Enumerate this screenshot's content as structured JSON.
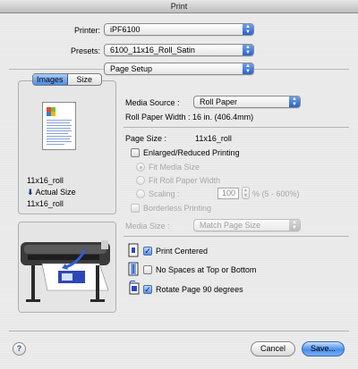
{
  "window": {
    "title": "Print"
  },
  "printer": {
    "label": "Printer:",
    "value": "iPF6100"
  },
  "presets": {
    "label": "Presets:",
    "value": "6100_11x16_Roll_Satin"
  },
  "panel": {
    "value": "Page Setup"
  },
  "preview_tabs": {
    "images": "Images",
    "size": "Size"
  },
  "preview_info": {
    "size": "11x16_roll",
    "actual_label": "Actual Size",
    "actual_value": "11x16_roll"
  },
  "media_source": {
    "label": "Media Source :",
    "value": "Roll Paper"
  },
  "roll_width": {
    "label": "Roll Paper Width :",
    "value": "16 in. (406.4mm)"
  },
  "page_size": {
    "label": "Page Size :",
    "value": "11x16_roll"
  },
  "enlarged": {
    "label": "Enlarged/Reduced Printing",
    "checked": false
  },
  "fit_media": {
    "label": "Fit Media Size",
    "selected": true
  },
  "fit_roll": {
    "label": "Fit Roll Paper Width",
    "selected": false
  },
  "scaling": {
    "label": "Scaling :",
    "value": "100",
    "range": "% (5 - 600%)",
    "selected": false
  },
  "borderless": {
    "label": "Borderless Printing",
    "checked": false
  },
  "media_size": {
    "label": "Media Size :",
    "value": "Match Page Size"
  },
  "print_centered": {
    "label": "Print Centered",
    "checked": true
  },
  "no_spaces": {
    "label": "No Spaces at Top or Bottom",
    "checked": false
  },
  "rotate": {
    "label": "Rotate Page 90 degrees",
    "checked": true
  },
  "buttons": {
    "help": "?",
    "cancel": "Cancel",
    "save": "Save..."
  },
  "colors": {
    "accent": "#4a8eea",
    "disabled_text": "#a7a7a7"
  }
}
